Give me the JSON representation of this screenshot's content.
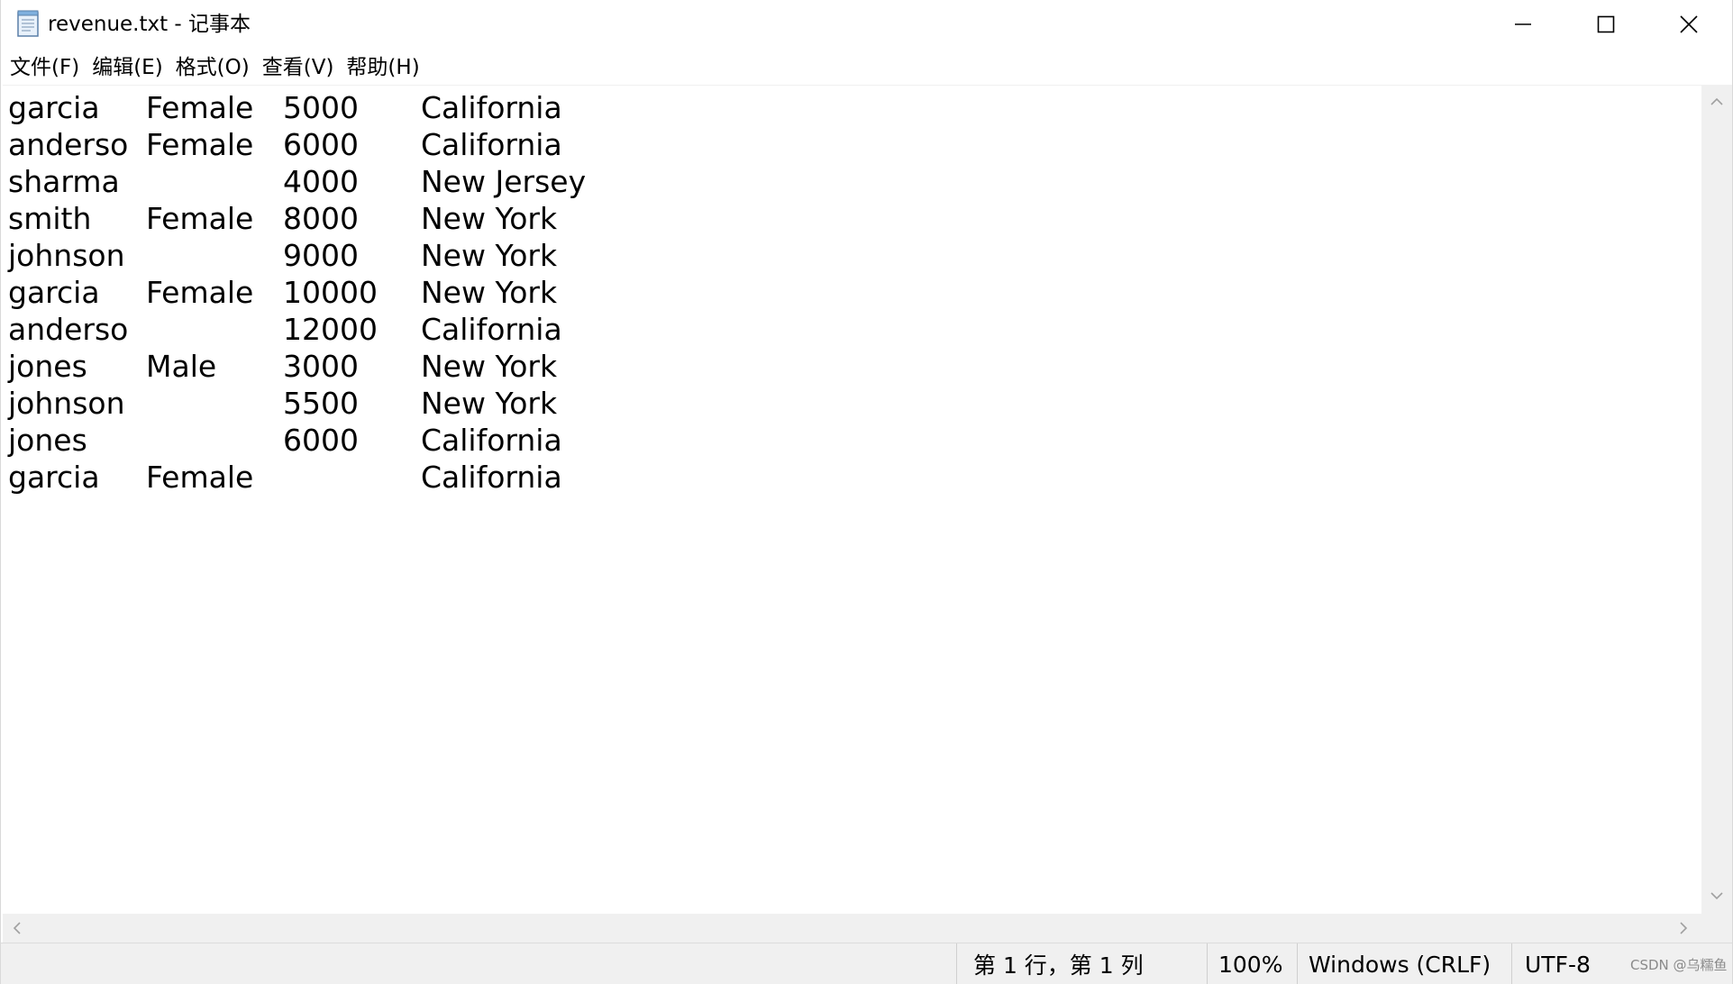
{
  "window": {
    "title": "revenue.txt - 记事本"
  },
  "menu": [
    {
      "label": "文件(F)"
    },
    {
      "label": "编辑(E)"
    },
    {
      "label": "格式(O)"
    },
    {
      "label": "查看(V)"
    },
    {
      "label": "帮助(H)"
    }
  ],
  "document": {
    "rows": [
      [
        "garcia",
        "Female",
        "5000",
        "California"
      ],
      [
        "anderso",
        "Female",
        "6000",
        "California"
      ],
      [
        "sharma",
        "",
        "4000",
        "New Jersey"
      ],
      [
        "smith",
        "Female",
        "8000",
        "New York"
      ],
      [
        "johnson",
        "",
        "9000",
        "New York"
      ],
      [
        "garcia",
        "Female",
        "10000",
        "New York"
      ],
      [
        "anderso",
        "",
        "12000",
        "California"
      ],
      [
        "jones",
        "Male",
        "3000",
        "New York"
      ],
      [
        "johnson",
        "",
        "5500",
        "New York"
      ],
      [
        "jones",
        "",
        "6000",
        "California"
      ],
      [
        "garcia",
        "Female",
        "",
        "California"
      ]
    ]
  },
  "status": {
    "position": "第 1 行，第 1 列",
    "zoom": "100%",
    "line_ending": "Windows (CRLF)",
    "encoding": "UTF-8"
  },
  "watermark": "CSDN @乌糯鱼",
  "icons": {
    "app": "notepad-icon",
    "minimize": "minimize-icon",
    "maximize": "maximize-icon",
    "close": "close-icon"
  }
}
